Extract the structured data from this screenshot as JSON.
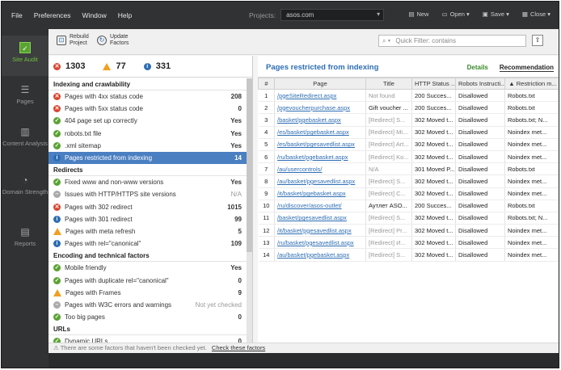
{
  "menu": [
    "File",
    "Preferences",
    "Window",
    "Help"
  ],
  "projects": {
    "label": "Projects:",
    "selected": "asos.com"
  },
  "top_buttons": [
    {
      "icon": "new-icon",
      "label": "New"
    },
    {
      "icon": "open-icon",
      "label": "Open"
    },
    {
      "icon": "save-icon",
      "label": "Save"
    },
    {
      "icon": "close-icon",
      "label": "Close"
    }
  ],
  "sidebar": [
    {
      "label": "Site Audit",
      "icon": "check-icon",
      "active": true
    },
    {
      "label": "Pages",
      "icon": "pages-icon"
    },
    {
      "label": "Content Analysis",
      "icon": "chart-icon"
    },
    {
      "label": "Domain Strength",
      "icon": "gauge-icon"
    },
    {
      "label": "Reports",
      "icon": "report-icon"
    }
  ],
  "toolbar": {
    "rebuild": "Rebuild Project",
    "update": "Update Factors",
    "filter_placeholder": "Quick Filter: contains"
  },
  "counts": {
    "errors": "1303",
    "warnings": "77",
    "info": "331"
  },
  "groups": [
    {
      "title": "Indexing and crawlability",
      "rows": [
        {
          "s": "err",
          "label": "Pages with 4xx status code",
          "value": "208"
        },
        {
          "s": "err",
          "label": "Pages with 5xx status code",
          "value": "0"
        },
        {
          "s": "ok",
          "label": "404 page set up correctly",
          "value": "Yes"
        },
        {
          "s": "ok",
          "label": "robots.txt file",
          "value": "Yes"
        },
        {
          "s": "ok",
          "label": ".xml sitemap",
          "value": "Yes"
        },
        {
          "s": "info",
          "label": "Pages restricted from indexing",
          "value": "14",
          "selected": true
        }
      ]
    },
    {
      "title": "Redirects",
      "rows": [
        {
          "s": "ok",
          "label": "Fixed www and non-www versions",
          "value": "Yes"
        },
        {
          "s": "na",
          "label": "Issues with HTTP/HTTPS site versions",
          "value": "N/A",
          "na": true
        },
        {
          "s": "err",
          "label": "Pages with 302 redirect",
          "value": "1015"
        },
        {
          "s": "info",
          "label": "Pages with 301 redirect",
          "value": "99"
        },
        {
          "s": "warn",
          "label": "Pages with meta refresh",
          "value": "5"
        },
        {
          "s": "info",
          "label": "Pages with rel=\"canonical\"",
          "value": "109"
        }
      ]
    },
    {
      "title": "Encoding and technical factors",
      "rows": [
        {
          "s": "ok",
          "label": "Mobile friendly",
          "value": "Yes"
        },
        {
          "s": "ok",
          "label": "Pages with duplicate rel=\"canonical\"",
          "value": "0"
        },
        {
          "s": "warn",
          "label": "Pages with Frames",
          "value": "9"
        },
        {
          "s": "na",
          "label": "Pages with W3C errors and warnings",
          "value": "Not yet checked",
          "na": true
        },
        {
          "s": "ok",
          "label": "Too big pages",
          "value": "0"
        }
      ]
    },
    {
      "title": "URLs",
      "rows": [
        {
          "s": "ok",
          "label": "Dynamic URLs",
          "value": "0"
        }
      ]
    }
  ],
  "right": {
    "title": "Pages restricted from indexing",
    "tab_details": "Details",
    "tab_recommendation": "Recommendation",
    "columns": [
      "#",
      "Page",
      "Title",
      "HTTP Status ...",
      "Robots Instructi...",
      "▲ Restriction m..."
    ],
    "rows": [
      [
        "1",
        "/pgeSiteRedirect.aspx",
        "Not found",
        "200 Succes...",
        "Disallowed",
        "Robots.txt"
      ],
      [
        "2",
        "/pgevoucherpurchase.aspx",
        "Gift voucher ...",
        "200 Succes...",
        "Disallowed",
        "Robots.txt"
      ],
      [
        "3",
        "/basket/pgebasket.aspx",
        "[Redirect] S...",
        "302 Moved t...",
        "Disallowed",
        "Robots.txt; N..."
      ],
      [
        "4",
        "/es/basket/pgebasket.aspx",
        "[Redirect] Mi...",
        "302 Moved t...",
        "Disallowed",
        "Noindex met..."
      ],
      [
        "5",
        "/es/basket/pgesavedlist.aspx",
        "[Redirect] Art...",
        "302 Moved t...",
        "Disallowed",
        "Noindex met..."
      ],
      [
        "6",
        "/ru/basket/pgebasket.aspx",
        "[Redirect] Ko...",
        "302 Moved t...",
        "Disallowed",
        "Noindex met..."
      ],
      [
        "7",
        "/au/usercontrols/",
        "N/A",
        "301 Moved P...",
        "Disallowed",
        "Robots.txt"
      ],
      [
        "8",
        "/au/basket/pgesavedlist.aspx",
        "[Redirect] S...",
        "302 Moved t...",
        "Disallowed",
        "Noindex met..."
      ],
      [
        "9",
        "/it/basket/pgebasket.aspx",
        "[Redirect] C...",
        "302 Moved t...",
        "Disallowed",
        "Noindex met..."
      ],
      [
        "10",
        "/ru/discover/asos-outlet/",
        "Аутлет ASO...",
        "200 Succes...",
        "Disallowed",
        "Robots.txt"
      ],
      [
        "11",
        "/basket/pgesavedlist.aspx",
        "[Redirect] S...",
        "302 Moved t...",
        "Disallowed",
        "Robots.txt; N..."
      ],
      [
        "12",
        "/it/basket/pgesavedlist.aspx",
        "[Redirect] Pr...",
        "302 Moved t...",
        "Disallowed",
        "Noindex met..."
      ],
      [
        "13",
        "/ru/basket/pgesavedlist.aspx",
        "[Redirect] И...",
        "302 Moved t...",
        "Disallowed",
        "Noindex met..."
      ],
      [
        "14",
        "/au/basket/pgebasket.aspx",
        "[Redirect] S...",
        "302 Moved t...",
        "Disallowed",
        "Noindex met..."
      ]
    ]
  },
  "status": {
    "text": "There are some factors that haven't been checked yet.",
    "link": "Check these factors"
  }
}
